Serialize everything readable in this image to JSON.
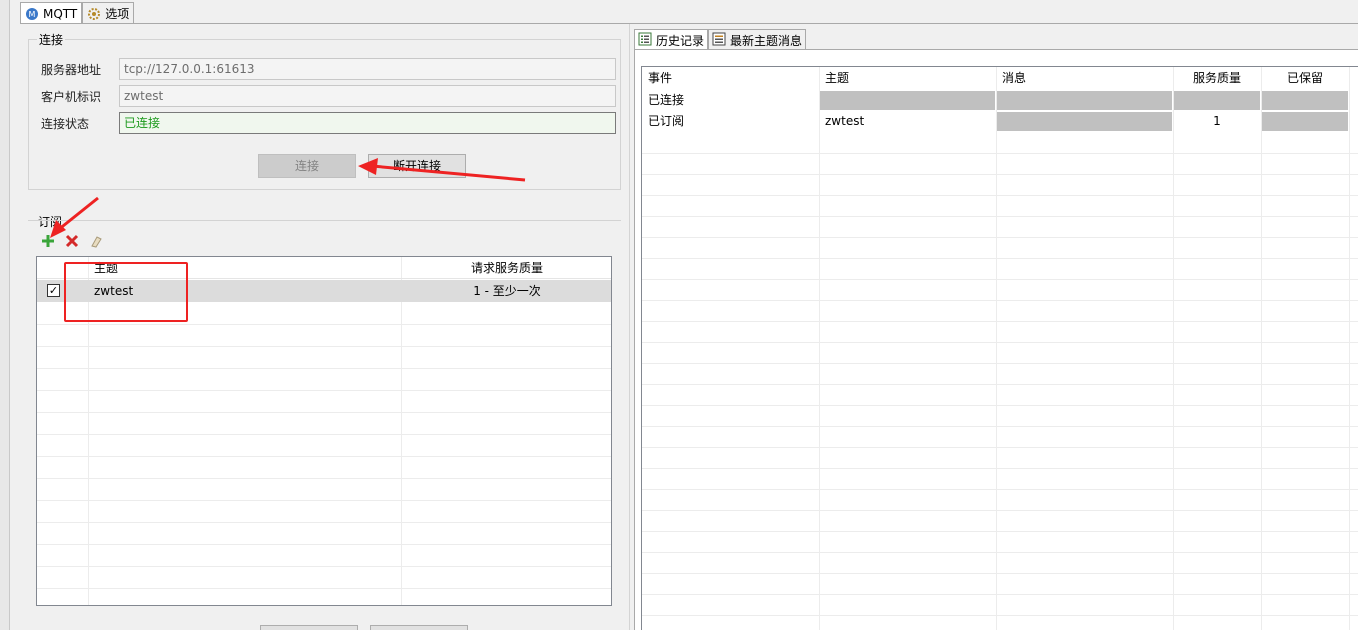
{
  "main_tabs": [
    {
      "label": "MQTT",
      "icon": "mqtt-icon"
    },
    {
      "label": "选项",
      "icon": "gear-icon"
    }
  ],
  "connection": {
    "group_title": "连接",
    "server_label": "服务器地址",
    "server_value": "tcp://127.0.0.1:61613",
    "client_label": "客户机标识",
    "client_value": "zwtest",
    "status_label": "连接状态",
    "status_value": "已连接",
    "connect_button": "连接",
    "disconnect_button": "断开连接"
  },
  "subscription": {
    "group_title": "订阅",
    "toolbar": [
      "add-icon",
      "delete-icon",
      "eraser-icon"
    ],
    "columns": [
      "主题",
      "请求服务质量"
    ],
    "rows": [
      {
        "checked": true,
        "topic": "zwtest",
        "qos": "1 - 至少一次"
      }
    ]
  },
  "right_tabs": [
    {
      "label": "历史记录",
      "icon": "list-icon"
    },
    {
      "label": "最新主题消息",
      "icon": "table-icon"
    }
  ],
  "history": {
    "columns": [
      "事件",
      "主题",
      "消息",
      "服务质量",
      "已保留"
    ],
    "rows": [
      {
        "event": "已连接",
        "topic": "",
        "message": "",
        "qos": "",
        "retained": ""
      },
      {
        "event": "已订阅",
        "topic": "zwtest",
        "message": "",
        "qos": "1",
        "retained": ""
      }
    ]
  },
  "colors": {
    "status_green": "#1c9a1c",
    "annotation_red": "#ee2222",
    "gray_cell": "#c0c0c0"
  }
}
